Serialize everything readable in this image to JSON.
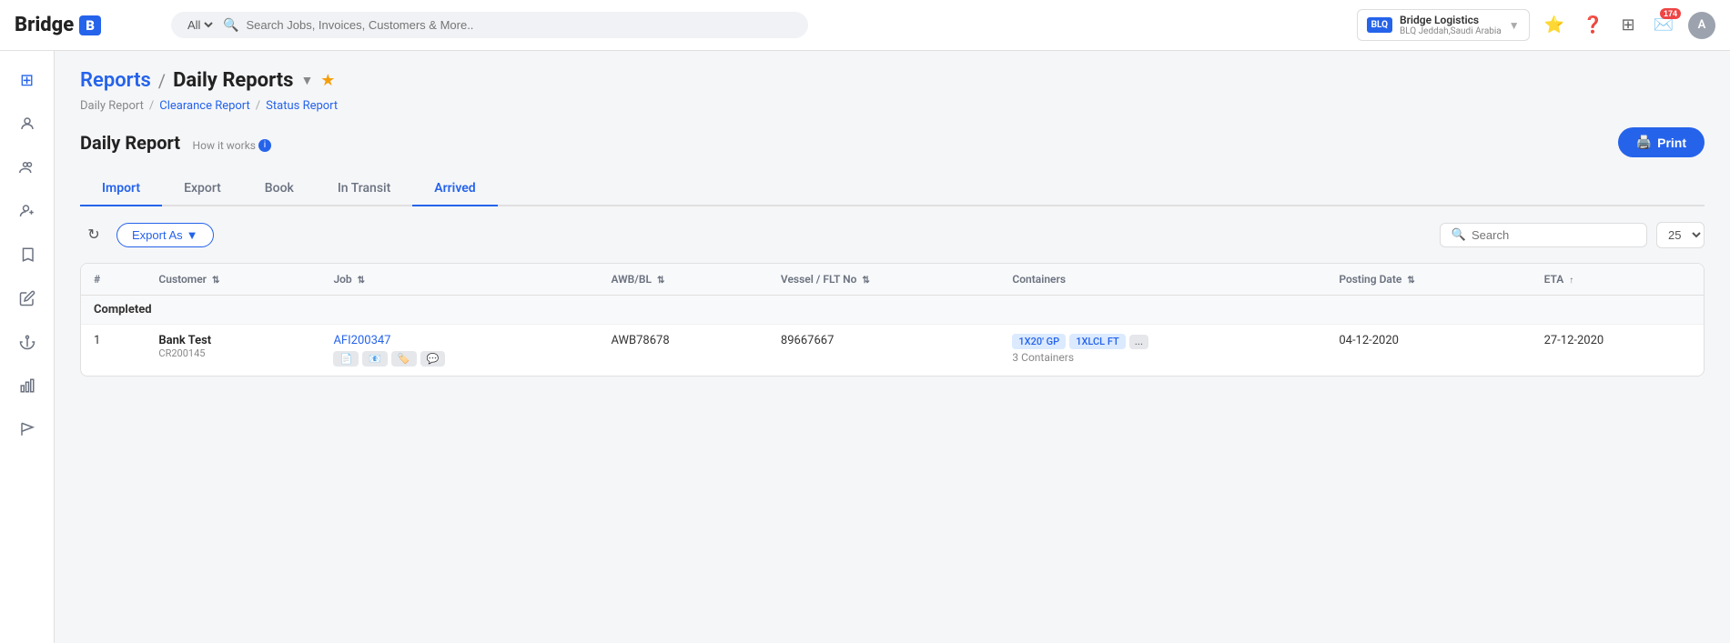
{
  "topnav": {
    "logo_text": "Bridge",
    "logo_icon": "B",
    "search_placeholder": "Search Jobs, Invoices, Customers & More..",
    "search_filter_options": [
      "All"
    ],
    "company": {
      "logo": "BLQ",
      "name": "Bridge Logistics",
      "sub": "BLQ Jeddah,Saudi Arabia"
    },
    "notifications_count": "174",
    "avatar_initial": "A"
  },
  "sidebar": {
    "items": [
      {
        "name": "dashboard",
        "icon": "⊞",
        "active": true
      },
      {
        "name": "contacts",
        "icon": "👤"
      },
      {
        "name": "team",
        "icon": "👥"
      },
      {
        "name": "add-user",
        "icon": "👤+"
      },
      {
        "name": "bookmarks",
        "icon": "🔖"
      },
      {
        "name": "edit",
        "icon": "✏️"
      },
      {
        "name": "anchor",
        "icon": "⚓"
      },
      {
        "name": "charts",
        "icon": "📊"
      },
      {
        "name": "flag",
        "icon": "🚩"
      }
    ]
  },
  "page": {
    "reports_label": "Reports",
    "title": "Daily Reports",
    "breadcrumbs": [
      {
        "label": "Daily Report",
        "link": false
      },
      {
        "label": "Clearance Report",
        "link": true
      },
      {
        "label": "Status Report",
        "link": true
      }
    ],
    "report_title": "Daily Report",
    "how_it_works": "How it works",
    "print_label": "Print",
    "tabs": [
      {
        "label": "Import",
        "active": true
      },
      {
        "label": "Export",
        "active": false
      },
      {
        "label": "Book",
        "active": false
      },
      {
        "label": "In Transit",
        "active": false
      },
      {
        "label": "Arrived",
        "active": true
      }
    ],
    "toolbar": {
      "export_label": "Export As",
      "search_placeholder": "Search",
      "page_size": "25"
    },
    "table": {
      "columns": [
        {
          "label": "#",
          "sortable": false
        },
        {
          "label": "Customer",
          "sortable": true
        },
        {
          "label": "Job",
          "sortable": true
        },
        {
          "label": "AWB/BL",
          "sortable": true
        },
        {
          "label": "Vessel / FLT No",
          "sortable": true
        },
        {
          "label": "Containers",
          "sortable": false
        },
        {
          "label": "Posting Date",
          "sortable": true
        },
        {
          "label": "ETA",
          "sortable": true
        }
      ],
      "sections": [
        {
          "section_label": "Completed",
          "rows": [
            {
              "num": "1",
              "customer_name": "Bank Test",
              "customer_ref": "CR200145",
              "job": "AFI200347",
              "job_icons": [
                "📄",
                "📧",
                "🏷️",
                "💬"
              ],
              "awb_bl": "AWB78678",
              "vessel": "89667667",
              "containers_badges": [
                "1X20' GP",
                "1XLCL FT",
                "..."
              ],
              "containers_count": "3 Containers",
              "posting_date": "04-12-2020",
              "eta": "27-12-2020"
            }
          ]
        }
      ]
    }
  }
}
